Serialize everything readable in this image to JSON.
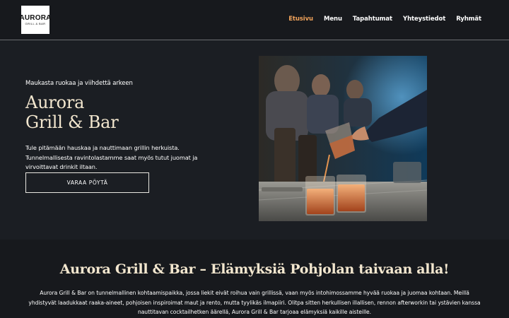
{
  "brand": {
    "logo_main": "AURORA",
    "logo_sub": "GRILL & BAR"
  },
  "nav": {
    "items": [
      {
        "label": "Etusivu",
        "active": true
      },
      {
        "label": "Menu",
        "active": false
      },
      {
        "label": "Tapahtumat",
        "active": false
      },
      {
        "label": "Yhteystiedot",
        "active": false
      },
      {
        "label": "Ryhmät",
        "active": false
      }
    ]
  },
  "hero": {
    "tagline": "Maukasta ruokaa ja viihdettä arkeen",
    "title_line1": "Aurora",
    "title_line2": "Grill & Bar",
    "description": "Tule pitämään hauskaa ja nauttimaan grillin herkuista. Tunnelmallisesta ravintolastamme saat myös tutut juomat ja virvoittavat drinkit iltaan.",
    "cta_label": "VARAA PÖYTÄ"
  },
  "about": {
    "title": "Aurora Grill & Bar – Elämyksiä Pohjolan taivaan alla!",
    "text": "Aurora Grill & Bar on tunnelmallinen kohtaamispaikka, jossa liekit eivät roihua vain grillissä, vaan myös intohimossamme hyvää ruokaa ja juomaa kohtaan. Meillä yhdistyvät laadukkaat raaka-aineet, pohjoisen inspiroimat maut ja rento, mutta tyylikäs ilmapiiri. Olitpa sitten herkullisen illallisen, rennon afterworkin tai ystävien kanssa nauttitavan cocktailhetken äärellä, Aurora Grill & Bar tarjoaa elämyksiä kaikille aisteille."
  },
  "colors": {
    "background": "#1b1e23",
    "header_bg": "#17191d",
    "accent": "#f0a25a",
    "heading": "#f3e7cf"
  }
}
